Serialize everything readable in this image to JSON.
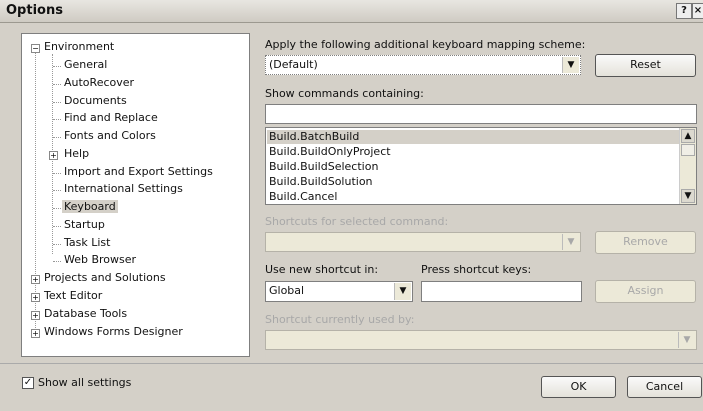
{
  "window": {
    "title": "Options",
    "help_glyph": "?",
    "close_glyph": "×"
  },
  "tree": {
    "environment": "Environment",
    "env_children": [
      "General",
      "AutoRecover",
      "Documents",
      "Find and Replace",
      "Fonts and Colors",
      "Help",
      "Import and Export Settings",
      "International Settings",
      "Keyboard",
      "Startup",
      "Task List",
      "Web Browser"
    ],
    "top_nodes": [
      "Projects and Solutions",
      "Text Editor",
      "Database Tools",
      "Windows Forms Designer"
    ],
    "expand_minus": "−",
    "expand_plus": "+"
  },
  "keyboard": {
    "mapping_label": "Apply the following additional keyboard mapping scheme:",
    "mapping_value": "(Default)",
    "reset_label": "Reset",
    "show_commands_label": "Show commands containing:",
    "search_value": "",
    "commands": [
      "Build.BatchBuild",
      "Build.BuildOnlyProject",
      "Build.BuildSelection",
      "Build.BuildSolution",
      "Build.Cancel"
    ],
    "shortcuts_label": "Shortcuts for selected command:",
    "shortcuts_value": "",
    "remove_label": "Remove",
    "use_new_label": "Use new shortcut in:",
    "use_new_value": "Global",
    "press_keys_label": "Press shortcut keys:",
    "press_keys_value": "",
    "assign_label": "Assign",
    "currently_used_label": "Shortcut currently used by:",
    "currently_used_value": ""
  },
  "footer": {
    "show_all_label": "Show all settings",
    "show_all_checked": true,
    "ok_label": "OK",
    "cancel_label": "Cancel"
  },
  "icons": {
    "dropdown": "▼",
    "scroll_up": "▲",
    "scroll_down": "▼",
    "check": "✓"
  }
}
